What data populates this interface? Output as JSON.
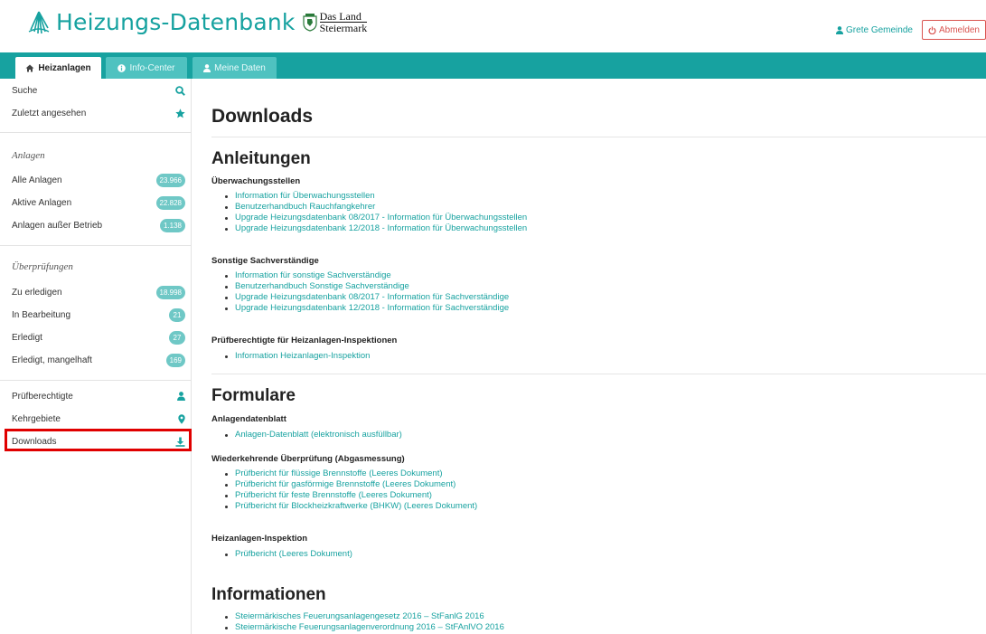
{
  "header": {
    "app_title": "Heizungs-Datenbank",
    "land_line1": "Das Land",
    "land_line2": "Steiermark",
    "user_name": "Grete Gemeinde",
    "logout_label": "Abmelden"
  },
  "tabs": [
    {
      "label": "Heizanlagen"
    },
    {
      "label": "Info-Center"
    },
    {
      "label": "Meine Daten"
    }
  ],
  "sidebar": {
    "search": "Suche",
    "recent": "Zuletzt angesehen",
    "anlagen_heading": "Anlagen",
    "anlagen": [
      {
        "label": "Alle Anlagen",
        "count": "23.966"
      },
      {
        "label": "Aktive Anlagen",
        "count": "22.828"
      },
      {
        "label": "Anlagen außer Betrieb",
        "count": "1.138"
      }
    ],
    "ueberpruefungen_heading": "Überprüfungen",
    "ueberpruefungen": [
      {
        "label": "Zu erledigen",
        "count": "18.998"
      },
      {
        "label": "In Bearbeitung",
        "count": "21"
      },
      {
        "label": "Erledigt",
        "count": "27"
      },
      {
        "label": "Erledigt, mangelhaft",
        "count": "169"
      }
    ],
    "pruefberechtigte": "Prüfberechtigte",
    "kehrgebiete": "Kehrgebiete",
    "downloads": "Downloads"
  },
  "main": {
    "title": "Downloads",
    "anleitungen": {
      "title": "Anleitungen",
      "groups": [
        {
          "title": "Überwachungsstellen",
          "links": [
            "Information für Überwachungsstellen",
            "Benutzerhandbuch Rauchfangkehrer",
            "Upgrade Heizungsdatenbank 08/2017 - Information für Überwachungsstellen",
            "Upgrade Heizungsdatenbank 12/2018 - Information für Überwachungsstellen"
          ]
        },
        {
          "title": "Sonstige Sachverständige",
          "links": [
            "Information für sonstige Sachverständige",
            "Benutzerhandbuch Sonstige Sachverständige",
            "Upgrade Heizungsdatenbank 08/2017 - Information für Sachverständige",
            "Upgrade Heizungsdatenbank 12/2018 - Information für Sachverständige"
          ]
        },
        {
          "title": "Prüfberechtigte für Heizanlagen-Inspektionen",
          "links": [
            "Information Heizanlagen-Inspektion"
          ]
        }
      ]
    },
    "formulare": {
      "title": "Formulare",
      "groups": [
        {
          "title": "Anlagendatenblatt",
          "links": [
            "Anlagen-Datenblatt (elektronisch ausfüllbar)"
          ]
        },
        {
          "title": "Wiederkehrende Überprüfung (Abgasmessung)",
          "links": [
            "Prüfbericht für flüssige Brennstoffe (Leeres Dokument)",
            "Prüfbericht für gasförmige Brennstoffe (Leeres Dokument)",
            "Prüfbericht für feste Brennstoffe (Leeres Dokument)",
            "Prüfbericht für Blockheizkraftwerke (BHKW) (Leeres Dokument)"
          ]
        },
        {
          "title": "Heizanlagen-Inspektion",
          "links": [
            "Prüfbericht (Leeres Dokument)"
          ]
        }
      ]
    },
    "informationen": {
      "title": "Informationen",
      "links": [
        "Steiermärkisches Feuerungsanlagengesetz 2016 – StFanlG 2016",
        "Steiermärkische Feuerungsanlagenverordnung 2016 – StFAnlVO 2016"
      ]
    }
  },
  "colors": {
    "accent": "#17a2a0",
    "badge": "#6fc8c6",
    "logout": "#d9534f",
    "highlight": "#e00000"
  }
}
